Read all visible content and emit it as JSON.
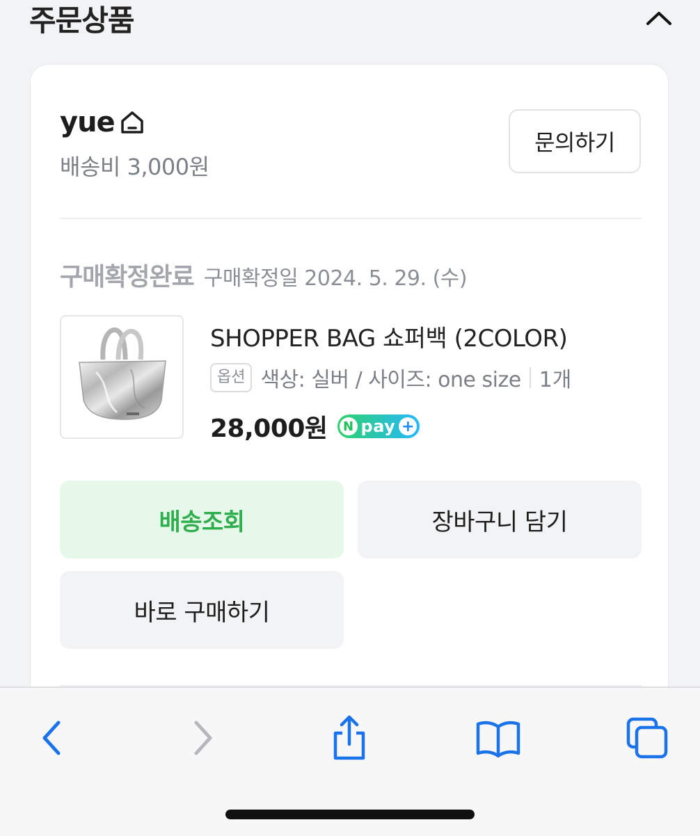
{
  "section": {
    "title": "주문상품"
  },
  "seller": {
    "name": "yue",
    "shipping": "배송비 3,000원",
    "inquiry_label": "문의하기"
  },
  "order": {
    "status": "구매확정완료",
    "confirmed_date": "구매확정일 2024. 5. 29. (수)"
  },
  "product": {
    "name": "SHOPPER BAG 쇼퍼백 (2COLOR)",
    "option_badge": "옵션",
    "option_text": "색상: 실버 / 사이즈: one size",
    "quantity": "1개",
    "price": "28,000원",
    "pay_badge": {
      "n": "N",
      "text": "pay",
      "plus": "+"
    }
  },
  "actions": {
    "track_label": "배송조회",
    "cart_label": "장바구니 담기",
    "buy_label": "바로 구매하기"
  },
  "colors": {
    "accent_green": "#2eae4d",
    "track_bg": "#e6f8e9",
    "ios_blue": "#1a73e8"
  },
  "toolbar": {
    "icons": [
      "back-icon",
      "forward-icon",
      "share-icon",
      "bookmarks-icon",
      "tabs-icon"
    ]
  }
}
